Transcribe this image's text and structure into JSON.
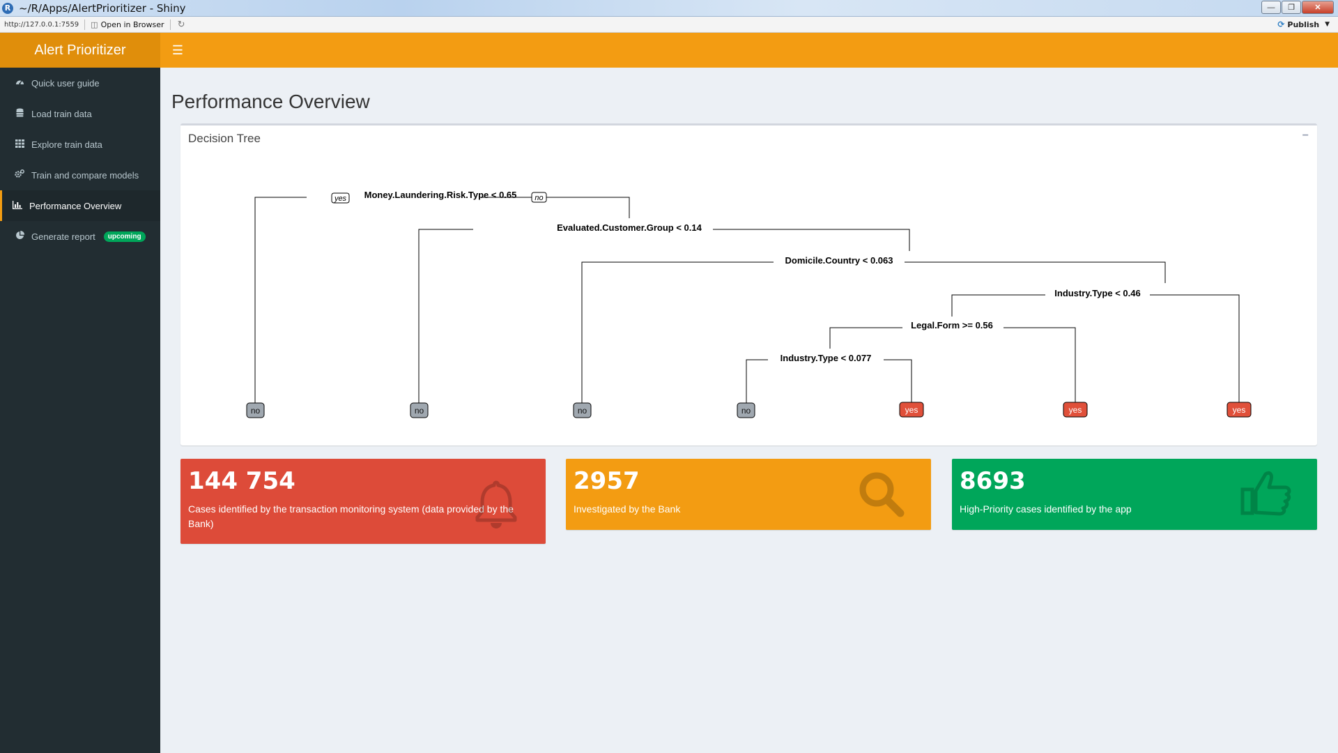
{
  "window": {
    "title": "~/R/Apps/AlertPrioritizer - Shiny",
    "url": "http://127.0.0.1:7559",
    "open_in_browser": "Open in Browser",
    "publish": "Publish"
  },
  "app": {
    "name": "Alert Prioritizer"
  },
  "sidebar": {
    "items": [
      {
        "label": "Quick user guide",
        "icon": "dashboard-icon"
      },
      {
        "label": "Load train data",
        "icon": "database-icon"
      },
      {
        "label": "Explore train data",
        "icon": "table-icon"
      },
      {
        "label": "Train and compare models",
        "icon": "gears-icon"
      },
      {
        "label": "Performance Overview",
        "icon": "bar-chart-icon",
        "active": true
      },
      {
        "label": "Generate report",
        "icon": "pie-chart-icon",
        "badge": "upcoming"
      }
    ]
  },
  "page": {
    "title": "Performance Overview"
  },
  "tree_box": {
    "title": "Decision Tree",
    "collapse_symbol": "−",
    "branch_labels": {
      "left": "yes",
      "right": "no"
    },
    "splits": [
      "Money.Laundering.Risk.Type < 0.65",
      "Evaluated.Customer.Group < 0.14",
      "Domicile.Country < 0.063",
      "Industry.Type < 0.46",
      "Legal.Form >= 0.56",
      "Industry.Type < 0.077"
    ],
    "leaves": [
      "no",
      "no",
      "no",
      "no",
      "yes",
      "yes",
      "yes"
    ]
  },
  "value_boxes": [
    {
      "value": "144 754",
      "label": "Cases identified by the transaction monitoring system (data provided by the Bank)",
      "icon": "bell-icon",
      "color": "#dd4b39"
    },
    {
      "value": "2957",
      "label": "Investigated by the Bank",
      "icon": "search-icon",
      "color": "#f39c12"
    },
    {
      "value": "8693",
      "label": "High-Priority cases identified by the app",
      "icon": "thumbs-up-icon",
      "color": "#00a65a"
    }
  ],
  "colors": {
    "accent": "#f39c12",
    "accent_dark": "#e08e0b",
    "sidebar": "#222d32",
    "leaf_no": "#a0a8b0",
    "leaf_yes": "#e0503a"
  }
}
